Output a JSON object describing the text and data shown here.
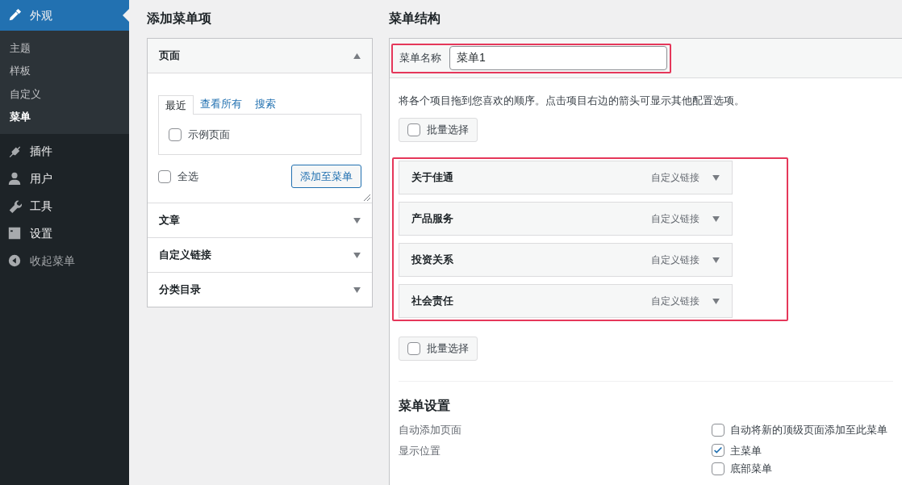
{
  "sidebar": {
    "items": [
      {
        "label": "外观",
        "selected": true,
        "children": [
          {
            "label": "主题",
            "selected": false
          },
          {
            "label": "样板",
            "selected": false
          },
          {
            "label": "自定义",
            "selected": false
          },
          {
            "label": "菜单",
            "selected": true
          }
        ]
      },
      {
        "label": "插件",
        "selected": false
      },
      {
        "label": "用户",
        "selected": false
      },
      {
        "label": "工具",
        "selected": false
      },
      {
        "label": "设置",
        "selected": false
      },
      {
        "label": "收起菜单",
        "selected": false
      }
    ]
  },
  "add_items": {
    "title": "添加菜单项",
    "sections": [
      {
        "title": "页面",
        "expanded": true,
        "tabs": [
          {
            "label": "最近",
            "selected": true
          },
          {
            "label": "查看所有",
            "selected": false
          },
          {
            "label": "搜索",
            "selected": false
          }
        ],
        "items": [
          {
            "label": "示例页面",
            "checked": false
          }
        ],
        "select_all": {
          "label": "全选",
          "checked": false
        },
        "button": "添加至菜单"
      },
      {
        "title": "文章",
        "expanded": false
      },
      {
        "title": "自定义链接",
        "expanded": false
      },
      {
        "title": "分类目录",
        "expanded": false
      }
    ]
  },
  "structure": {
    "title": "菜单结构",
    "name_label": "菜单名称",
    "name_value": "菜单1",
    "highlighted": true,
    "hint": "将各个项目拖到您喜欢的顺序。点击项目右边的箭头可显示其他配置选项。",
    "bulk_top": {
      "label": "批量选择",
      "checked": false
    },
    "items_highlighted": true,
    "items": [
      {
        "title": "关于佳通",
        "type": "自定义链接"
      },
      {
        "title": "产品服务",
        "type": "自定义链接"
      },
      {
        "title": "投资关系",
        "type": "自定义链接"
      },
      {
        "title": "社会责任",
        "type": "自定义链接"
      }
    ],
    "bulk_bottom": {
      "label": "批量选择",
      "checked": false
    },
    "settings": {
      "title": "菜单设置",
      "rows": [
        {
          "label": "自动添加页面",
          "options": [
            {
              "label": "自动将新的顶级页面添加至此菜单",
              "checked": false
            }
          ]
        },
        {
          "label": "显示位置",
          "options": [
            {
              "label": "主菜单",
              "checked": true
            },
            {
              "label": "底部菜单",
              "checked": false
            }
          ]
        }
      ]
    }
  }
}
